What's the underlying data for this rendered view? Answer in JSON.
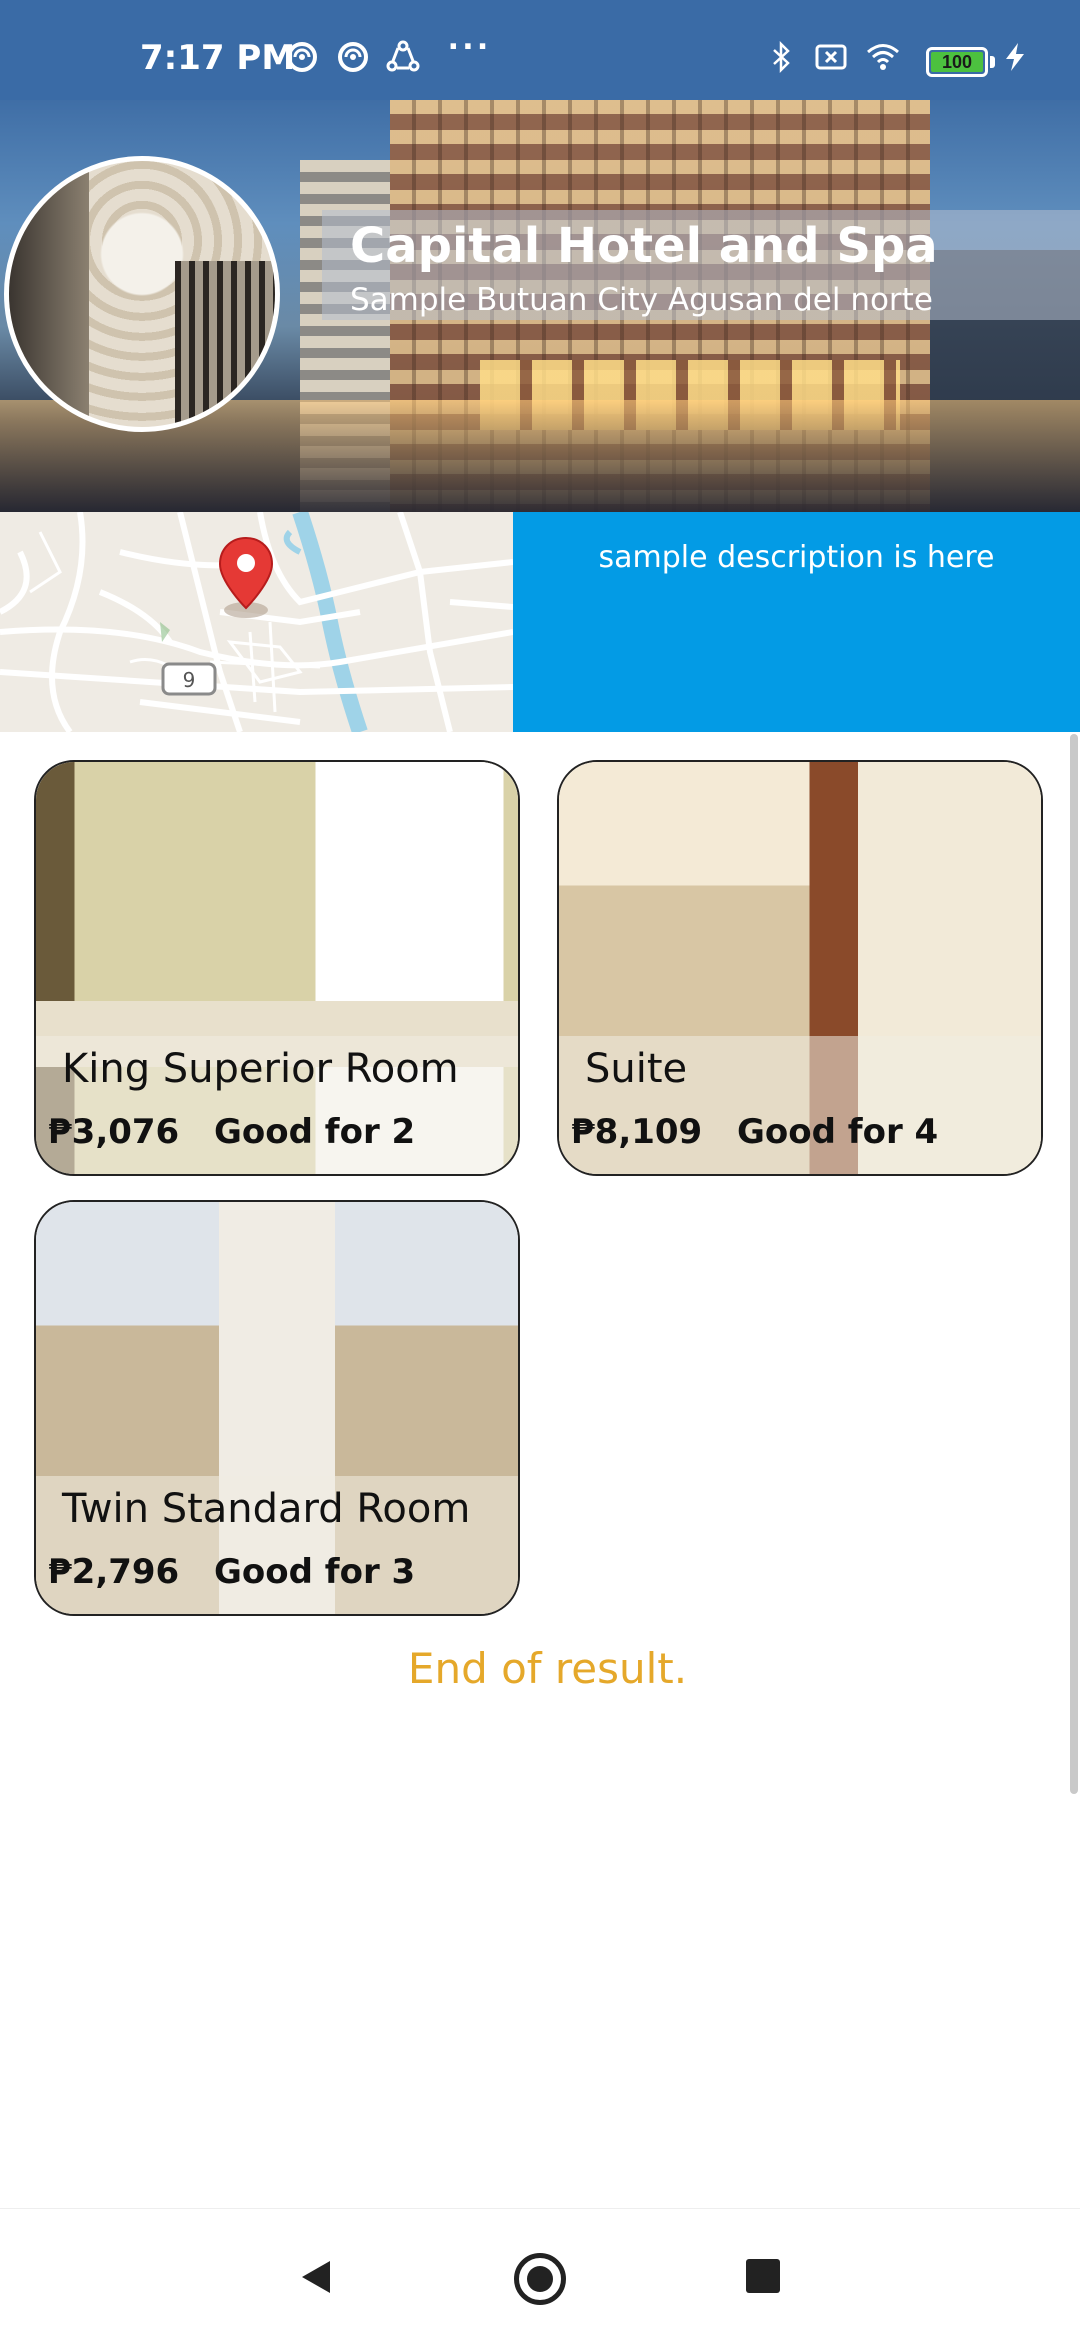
{
  "status_bar": {
    "time": "7:17 PM",
    "more_dots": "···",
    "battery_level": "100",
    "icons": [
      "sync-icon",
      "sync-icon",
      "share-icon",
      "bluetooth-icon",
      "no-sim-icon",
      "wifi-icon",
      "battery-icon",
      "charging-icon"
    ]
  },
  "hotel": {
    "name": "Capital Hotel and Spa",
    "address": "Sample Butuan City Agusan del norte",
    "description": "sample description is here",
    "map_road_label": "9"
  },
  "rooms": [
    {
      "name": "King Superior Room",
      "price": "₱3,076",
      "capacity": "Good for 2"
    },
    {
      "name": "Suite",
      "price": "₱8,109",
      "capacity": "Good for 4"
    },
    {
      "name": "Twin Standard Room",
      "price": "₱2,796",
      "capacity": "Good for 3"
    }
  ],
  "end_message": "End of result.",
  "colors": {
    "status_bar": "#3a6ba6",
    "description_bg": "#039be5",
    "end_text": "#e5a82a",
    "map_pin": "#e53935"
  },
  "nav": {
    "back": "back-icon",
    "home": "home-icon",
    "recents": "recents-icon"
  }
}
